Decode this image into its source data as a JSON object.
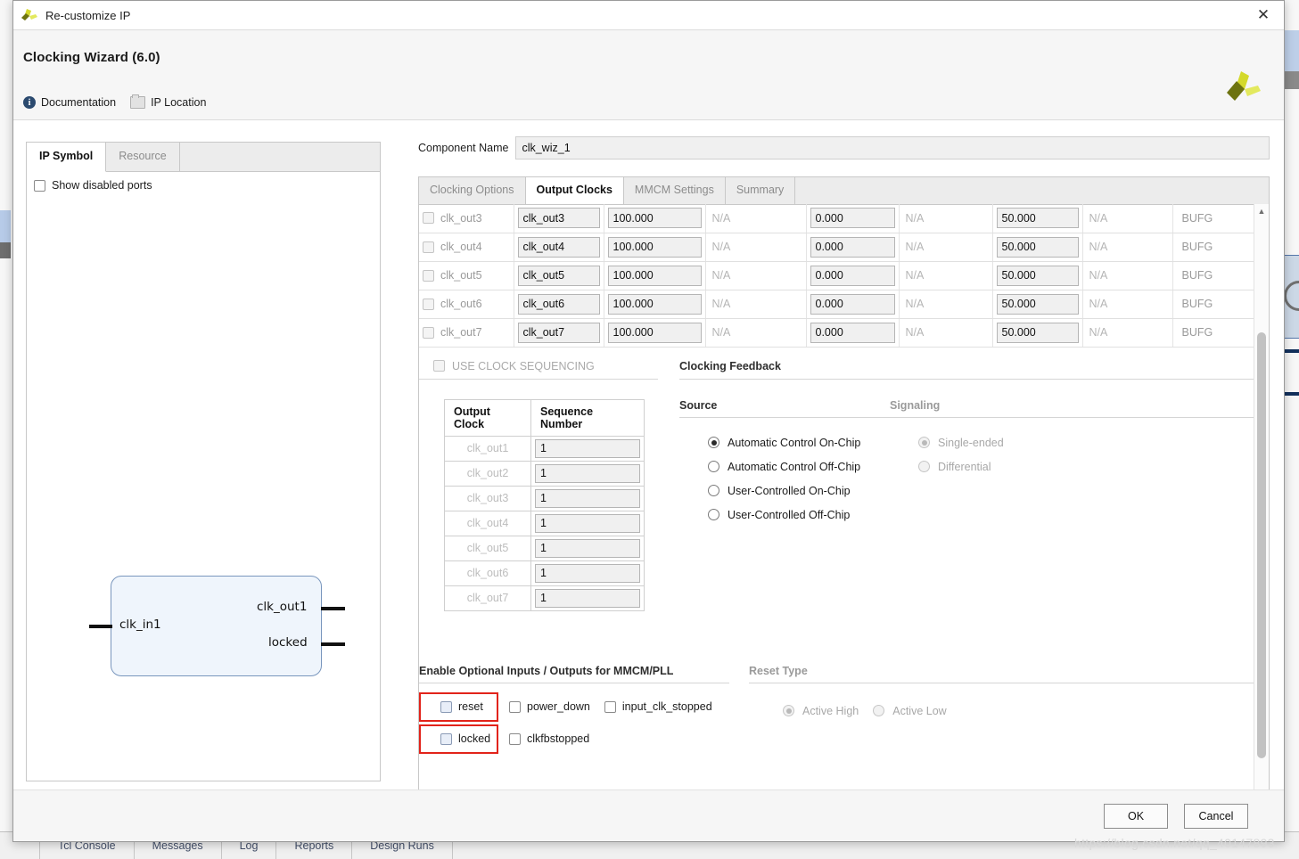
{
  "window": {
    "title": "Re-customize IP",
    "close_label": "✕",
    "logo_name": "xilinx-logo"
  },
  "header": {
    "title": "Clocking Wizard (6.0)",
    "links": [
      {
        "label": "Documentation",
        "icon": "info-icon"
      },
      {
        "label": "IP Location",
        "icon": "folder-icon"
      }
    ]
  },
  "left_panel": {
    "tabs": [
      {
        "label": "IP Symbol",
        "active": true
      },
      {
        "label": "Resource",
        "active": false
      }
    ],
    "show_disabled_ports": {
      "label": "Show disabled ports",
      "checked": false
    },
    "symbol": {
      "input_ports": [
        "clk_in1"
      ],
      "output_ports": [
        "clk_out1",
        "locked"
      ]
    }
  },
  "component": {
    "label": "Component Name",
    "value": "clk_wiz_1"
  },
  "main_tabs": [
    {
      "label": "Clocking Options",
      "active": false
    },
    {
      "label": "Output Clocks",
      "active": true
    },
    {
      "label": "MMCM Settings",
      "active": false
    },
    {
      "label": "Summary",
      "active": false
    }
  ],
  "clock_table": {
    "rows": [
      {
        "enabled": false,
        "port": "clk_out3",
        "name": "clk_out3",
        "req_freq": "100.000",
        "act_freq": "N/A",
        "req_phase": "0.000",
        "act_phase": "N/A",
        "req_duty": "50.000",
        "act_duty": "N/A",
        "driver": "BUFG",
        "clipped": true
      },
      {
        "enabled": false,
        "port": "clk_out4",
        "name": "clk_out4",
        "req_freq": "100.000",
        "act_freq": "N/A",
        "req_phase": "0.000",
        "act_phase": "N/A",
        "req_duty": "50.000",
        "act_duty": "N/A",
        "driver": "BUFG",
        "clipped": false
      },
      {
        "enabled": false,
        "port": "clk_out5",
        "name": "clk_out5",
        "req_freq": "100.000",
        "act_freq": "N/A",
        "req_phase": "0.000",
        "act_phase": "N/A",
        "req_duty": "50.000",
        "act_duty": "N/A",
        "driver": "BUFG",
        "clipped": false
      },
      {
        "enabled": false,
        "port": "clk_out6",
        "name": "clk_out6",
        "req_freq": "100.000",
        "act_freq": "N/A",
        "req_phase": "0.000",
        "act_phase": "N/A",
        "req_duty": "50.000",
        "act_duty": "N/A",
        "driver": "BUFG",
        "clipped": false
      },
      {
        "enabled": false,
        "port": "clk_out7",
        "name": "clk_out7",
        "req_freq": "100.000",
        "act_freq": "N/A",
        "req_phase": "0.000",
        "act_phase": "N/A",
        "req_duty": "50.000",
        "act_duty": "N/A",
        "driver": "BUFG",
        "clipped": false
      }
    ]
  },
  "sequencing": {
    "checkbox_label": "USE CLOCK SEQUENCING",
    "checked": false,
    "enabled": false,
    "headers": [
      "Output Clock",
      "Sequence Number"
    ],
    "rows": [
      {
        "clock": "clk_out1",
        "sequence": "1"
      },
      {
        "clock": "clk_out2",
        "sequence": "1"
      },
      {
        "clock": "clk_out3",
        "sequence": "1"
      },
      {
        "clock": "clk_out4",
        "sequence": "1"
      },
      {
        "clock": "clk_out5",
        "sequence": "1"
      },
      {
        "clock": "clk_out6",
        "sequence": "1"
      },
      {
        "clock": "clk_out7",
        "sequence": "1"
      }
    ]
  },
  "clocking_feedback": {
    "title": "Clocking Feedback",
    "source": {
      "title": "Source",
      "options": [
        {
          "label": "Automatic Control On-Chip",
          "selected": true
        },
        {
          "label": "Automatic Control Off-Chip",
          "selected": false
        },
        {
          "label": "User-Controlled On-Chip",
          "selected": false
        },
        {
          "label": "User-Controlled Off-Chip",
          "selected": false
        }
      ]
    },
    "signaling": {
      "title": "Signaling",
      "enabled": false,
      "options": [
        {
          "label": "Single-ended",
          "selected": true
        },
        {
          "label": "Differential",
          "selected": false
        }
      ]
    }
  },
  "optional_io": {
    "title": "Enable Optional Inputs / Outputs for MMCM/PLL",
    "row1": [
      {
        "label": "reset",
        "checked": false,
        "highlighted": true
      },
      {
        "label": "power_down",
        "checked": false,
        "highlighted": false
      },
      {
        "label": "input_clk_stopped",
        "checked": false,
        "highlighted": false
      }
    ],
    "row2": [
      {
        "label": "locked",
        "checked": false,
        "highlighted": true
      },
      {
        "label": "clkfbstopped",
        "checked": false,
        "highlighted": false
      }
    ],
    "highlight_color": "#e2231a"
  },
  "reset_type": {
    "title": "Reset Type",
    "enabled": false,
    "options": [
      {
        "label": "Active High",
        "selected": true
      },
      {
        "label": "Active Low",
        "selected": false
      }
    ]
  },
  "footer": {
    "ok_label": "OK",
    "cancel_label": "Cancel"
  },
  "background": {
    "tabs": [
      "Tcl Console",
      "Messages",
      "Log",
      "Reports",
      "Design Runs"
    ],
    "watermark": "https://blog.csdn.net/qq_40147893"
  }
}
